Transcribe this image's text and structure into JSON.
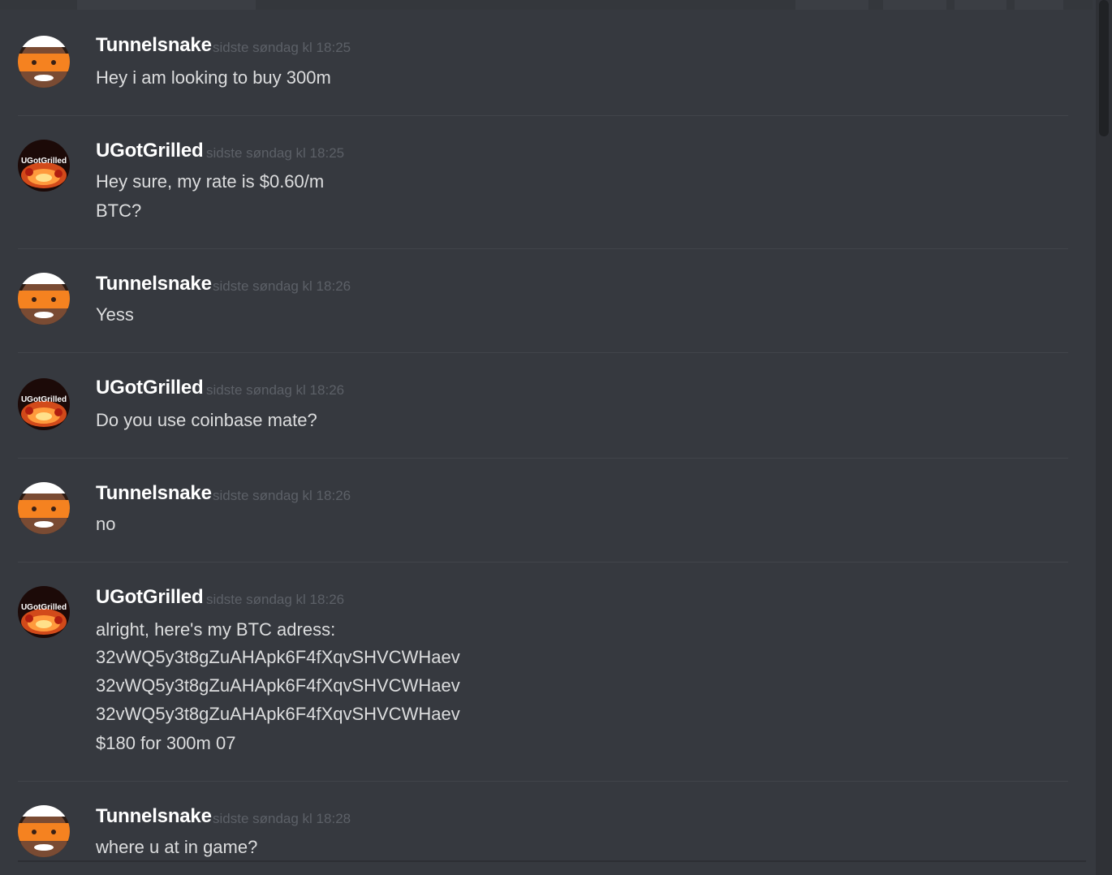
{
  "messages": [
    {
      "user": "Tunnelsnake",
      "time": "sidste søndag kl 18:25",
      "lines": [
        "Hey i am looking to buy 300m"
      ]
    },
    {
      "user": "UGotGrilled",
      "time": "sidste søndag kl 18:25",
      "lines": [
        "Hey sure, my rate is $0.60/m",
        "BTC?"
      ]
    },
    {
      "user": "Tunnelsnake",
      "time": "sidste søndag kl 18:26",
      "lines": [
        "Yess"
      ]
    },
    {
      "user": "UGotGrilled",
      "time": "sidste søndag kl 18:26",
      "lines": [
        "Do you use coinbase mate?"
      ]
    },
    {
      "user": "Tunnelsnake",
      "time": "sidste søndag kl 18:26",
      "lines": [
        "no"
      ]
    },
    {
      "user": "UGotGrilled",
      "time": "sidste søndag kl 18:26",
      "lines": [
        "alright, here's my BTC adress:",
        "32vWQ5y3t8gZuAHApk6F4fXqvSHVCWHaev",
        "32vWQ5y3t8gZuAHApk6F4fXqvSHVCWHaev",
        "32vWQ5y3t8gZuAHApk6F4fXqvSHVCWHaev",
        "$180 for 300m 07"
      ]
    },
    {
      "user": "Tunnelsnake",
      "time": "sidste søndag kl 18:28",
      "lines": [
        "where u at in game?"
      ]
    }
  ],
  "avatar_labels": {
    "ugotgrilled": "UGotGrilled"
  },
  "icons": {
    "tunnelsnake": "tunnelsnake-avatar-icon",
    "ugotgrilled": "ugotgrilled-avatar-icon"
  },
  "colors": {
    "background": "#36393f",
    "username": "#ffffff",
    "timestamp": "#5c6067",
    "text": "#dcddde",
    "divider": "#41444a"
  }
}
